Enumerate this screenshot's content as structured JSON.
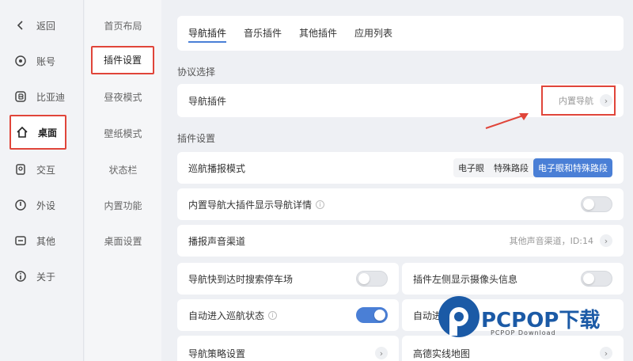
{
  "sidebar": {
    "items": [
      {
        "label": "返回",
        "icon": "chevron-left-icon"
      },
      {
        "label": "账号",
        "icon": "account-icon"
      },
      {
        "label": "比亚迪",
        "icon": "byd-logo-icon"
      },
      {
        "label": "桌面",
        "icon": "home-icon"
      },
      {
        "label": "交互",
        "icon": "interaction-icon"
      },
      {
        "label": "外设",
        "icon": "peripheral-icon"
      },
      {
        "label": "其他",
        "icon": "other-icon"
      },
      {
        "label": "关于",
        "icon": "about-icon"
      }
    ],
    "active_index": 3
  },
  "col2": {
    "items": [
      "首页布局",
      "插件设置",
      "昼夜模式",
      "壁纸模式",
      "状态栏",
      "内置功能",
      "桌面设置"
    ],
    "active_index": 1
  },
  "tabs": {
    "items": [
      "导航插件",
      "音乐插件",
      "其他插件",
      "应用列表"
    ],
    "active_index": 0
  },
  "protocol": {
    "section_title": "协议选择",
    "row_label": "导航插件",
    "row_value": "内置导航"
  },
  "plugin_settings": {
    "section_title": "插件设置",
    "cruise_mode": {
      "label": "巡航播报模式",
      "options": [
        "电子眼",
        "特殊路段",
        "电子眼和特殊路段"
      ],
      "selected_index": 2
    },
    "show_details": {
      "label": "内置导航大插件显示导航详情",
      "on": false
    },
    "audio_channel": {
      "label": "播报声音渠道",
      "value": "其他声音渠道，ID:14"
    },
    "search_parking": {
      "label": "导航快到达时搜索停车场",
      "on": false
    },
    "camera_info": {
      "label": "插件左侧显示摄像头信息",
      "on": false
    },
    "auto_cruise": {
      "label": "自动进入巡航状态",
      "on": true
    },
    "auto_right": {
      "label": "自动进"
    },
    "nav_strategy": {
      "label": "导航策略设置"
    },
    "row_bottom_right": {
      "label": "高德实线地图"
    }
  },
  "colors": {
    "accent": "#4a7fd6",
    "highlight": "#e0453a",
    "watermark": "#1b5aa6"
  },
  "watermark": {
    "brand": "PCPOP下载",
    "sub": "PCPOP Download"
  }
}
